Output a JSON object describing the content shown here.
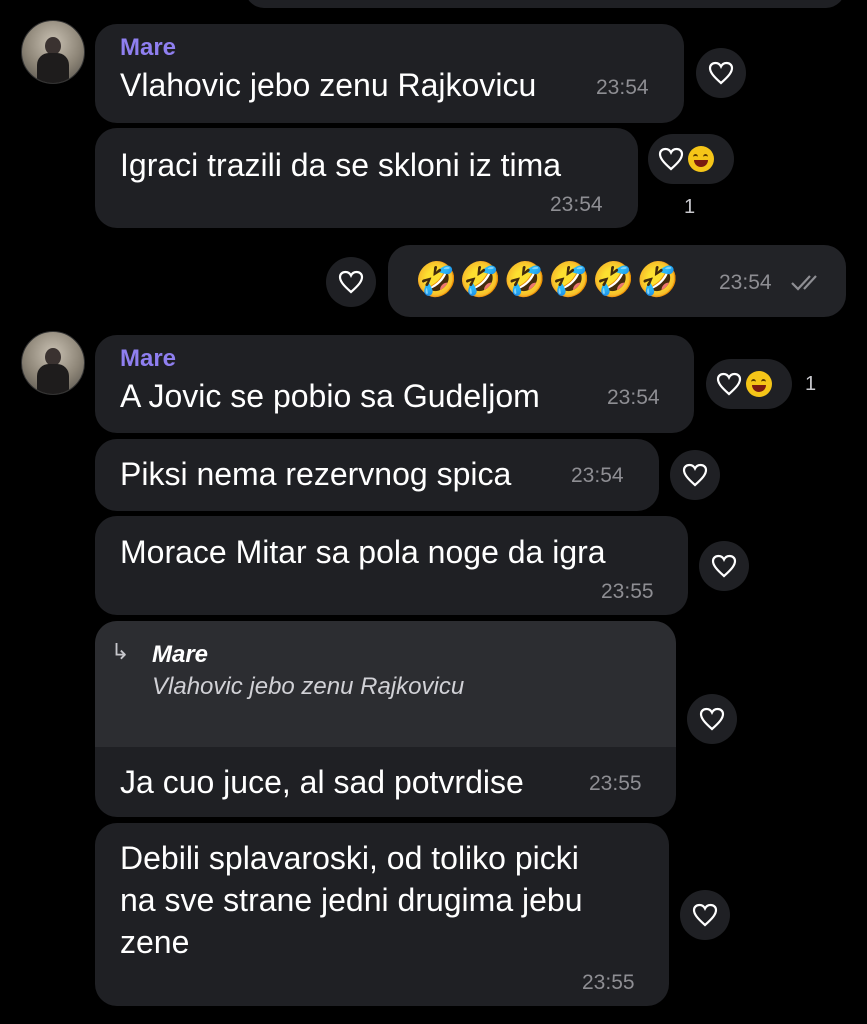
{
  "colors": {
    "background": "#000000",
    "bubble": "#1f2024",
    "sender": "#8f7ff0",
    "time": "#8e8e93"
  },
  "icons": {
    "reaction": "heart-icon",
    "read_status": "double-check-icon",
    "emoji": "grinning-squinting-face"
  },
  "messages": [
    {
      "sender": "Mare",
      "text": "Vlahovic jebo zenu Rajkovicu",
      "time": "23:54"
    },
    {
      "text": "Igraci trazili da se skloni iz tima",
      "time": "23:54",
      "reaction_count": "1"
    },
    {
      "outgoing": true,
      "text": "🤣🤣🤣🤣🤣🤣",
      "time": "23:54"
    },
    {
      "sender": "Mare",
      "text": "A Jovic se pobio sa Gudeljom",
      "time": "23:54",
      "reaction_count": "1"
    },
    {
      "text": "Piksi nema rezervnog spica",
      "time": "23:54"
    },
    {
      "text": "Morace Mitar sa pola noge da igra",
      "time": "23:55"
    },
    {
      "reply_to": {
        "sender": "Mare",
        "text": "Vlahovic jebo zenu Rajkovicu"
      },
      "text": "Ja cuo juce, al sad potvrdise",
      "time": "23:55"
    },
    {
      "lines": [
        "Debili splavaroski, od toliko picki",
        "na sve strane jedni drugima jebu",
        "zene"
      ],
      "time": "23:55"
    }
  ]
}
